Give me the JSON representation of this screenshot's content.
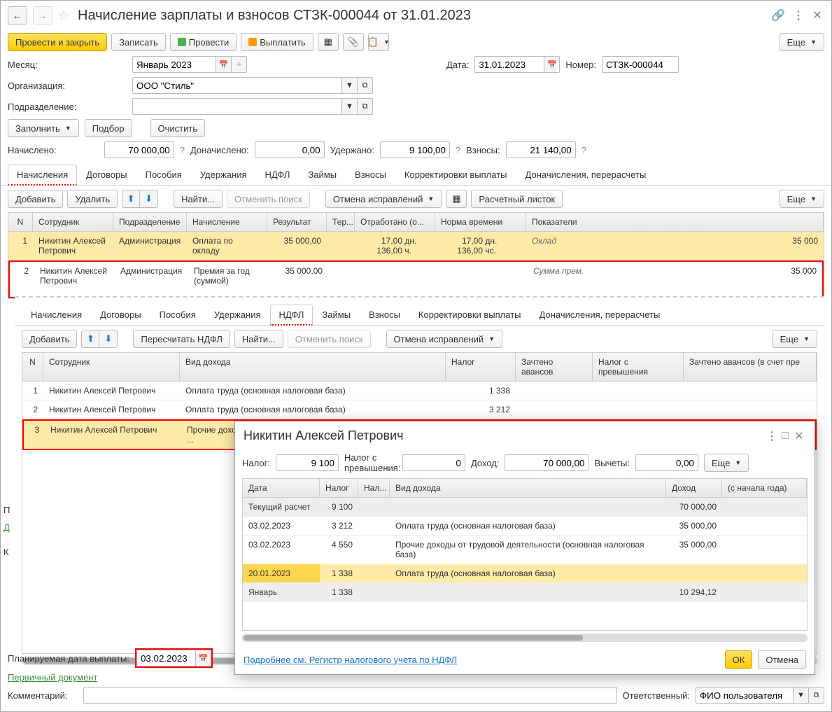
{
  "title": "Начисление зарплаты и взносов СТЗК-000044 от 31.01.2023",
  "toolbar": {
    "post_close": "Провести и закрыть",
    "save": "Записать",
    "post": "Провести",
    "pay": "Выплатить",
    "more": "Еще"
  },
  "form": {
    "month_label": "Месяц:",
    "month_value": "Январь 2023",
    "date_label": "Дата:",
    "date_value": "31.01.2023",
    "number_label": "Номер:",
    "number_value": "СТЗК-000044",
    "org_label": "Организация:",
    "org_value": "ООО \"Стиль\"",
    "dept_label": "Подразделение:",
    "dept_value": "",
    "fill": "Заполнить",
    "select": "Подбор",
    "clear": "Очистить",
    "accrued_label": "Начислено:",
    "accrued_value": "70 000,00",
    "addaccrued_label": "Доначислено:",
    "addaccrued_value": "0,00",
    "withheld_label": "Удержано:",
    "withheld_value": "9 100,00",
    "contrib_label": "Взносы:",
    "contrib_value": "21 140,00"
  },
  "tabs1": [
    "Начисления",
    "Договоры",
    "Пособия",
    "Удержания",
    "НДФЛ",
    "Займы",
    "Взносы",
    "Корректировки выплаты",
    "Доначисления, перерасчеты"
  ],
  "tabs2": [
    "Начисления",
    "Договоры",
    "Пособия",
    "Удержания",
    "НДФЛ",
    "Займы",
    "Взносы",
    "Корректировки выплаты",
    "Доначисления, перерасчеты"
  ],
  "subtb": {
    "add": "Добавить",
    "delete": "Удалить",
    "find": "Найти...",
    "cancel_search": "Отменить поиск",
    "cancel_corr": "Отмена исправлений",
    "payslip": "Расчетный листок",
    "more": "Еще",
    "recalc": "Пересчитать НДФЛ"
  },
  "table1": {
    "headers": {
      "n": "N",
      "emp": "Сотрудник",
      "dept": "Подразделение",
      "acc": "Начисление",
      "res": "Результат",
      "ter": "Тер...",
      "worked": "Отработано (о...",
      "norm": "Норма времени",
      "ind": "Показатели"
    },
    "rows": [
      {
        "n": "1",
        "emp": "Никитин Алексей Петрович",
        "dept": "Администрация",
        "acc": "Оплата по окладу",
        "res": "35 000,00",
        "worked_d": "17,00",
        "worked_du": "дн.",
        "worked_h": "136,00",
        "worked_hu": "ч.",
        "norm_d": "17,00",
        "norm_du": "дн.",
        "norm_h": "136,00",
        "norm_hu": "чс.",
        "ind": "Оклад",
        "ind_val": "35 000"
      },
      {
        "n": "2",
        "emp": "Никитин Алексей Петрович",
        "dept": "Администрация",
        "acc": "Премия за год (суммой)",
        "res": "35 000,00",
        "ind": "Сумма прем.",
        "ind_val": "35 000"
      }
    ]
  },
  "table2": {
    "headers": {
      "n": "N",
      "emp": "Сотрудник",
      "inc": "Вид дохода",
      "tax": "Налог",
      "adv": "Зачтено авансов",
      "over": "Налог с превышения",
      "adv2": "Зачтено авансов (в счет пре"
    },
    "rows": [
      {
        "n": "1",
        "emp": "Никитин Алексей Петрович",
        "inc": "Оплата труда (основная налоговая база)",
        "tax": "1 338"
      },
      {
        "n": "2",
        "emp": "Никитин Алексей Петрович",
        "inc": "Оплата труда (основная налоговая база)",
        "tax": "3 212"
      },
      {
        "n": "3",
        "emp": "Никитин Алексей Петрович",
        "inc": "Прочие доходы от трудовой деятельности (основная налоговая ...",
        "tax": "4 550"
      }
    ]
  },
  "popup": {
    "title": "Никитин Алексей Петрович",
    "tax_label": "Налог:",
    "tax_value": "9 100",
    "over_label": "Налог с превышения:",
    "over_value": "0",
    "income_label": "Доход:",
    "income_value": "70 000,00",
    "ded_label": "Вычеты:",
    "ded_value": "0,00",
    "more": "Еще",
    "headers": {
      "date": "Дата",
      "tax": "Налог",
      "taxo": "Нал...",
      "inc": "Вид дохода",
      "income": "Доход",
      "ytd": "(с начала года)"
    },
    "rows": [
      {
        "date": "Текущий расчет",
        "tax": "9 100",
        "inc": "",
        "income": "70 000,00"
      },
      {
        "date": "03.02.2023",
        "tax": "3 212",
        "inc": "Оплата труда (основная налоговая база)",
        "income": "35 000,00"
      },
      {
        "date": "03.02.2023",
        "tax": "4 550",
        "inc": "Прочие доходы от трудовой деятельности (основная налоговая база)",
        "income": "35 000,00"
      },
      {
        "date": "20.01.2023",
        "tax": "1 338",
        "inc": "Оплата труда (основная налоговая база)",
        "income": ""
      },
      {
        "date": "Январь",
        "tax": "1 338",
        "inc": "",
        "income": "10 294,12"
      }
    ],
    "link": "Подробнее см. Регистр налогового учета по НДФЛ",
    "ok": "ОК",
    "cancel": "Отмена"
  },
  "footer": {
    "plan_date_label": "Планируемая дата выплаты:",
    "plan_date_value": "03.02.2023",
    "primary_doc": "Первичный документ",
    "comment_label": "Комментарий:",
    "comment_value": "",
    "resp_label": "Ответственный:",
    "resp_value": "ФИО пользователя"
  },
  "side": {
    "p": "П",
    "d": "Д",
    "k": "К"
  }
}
